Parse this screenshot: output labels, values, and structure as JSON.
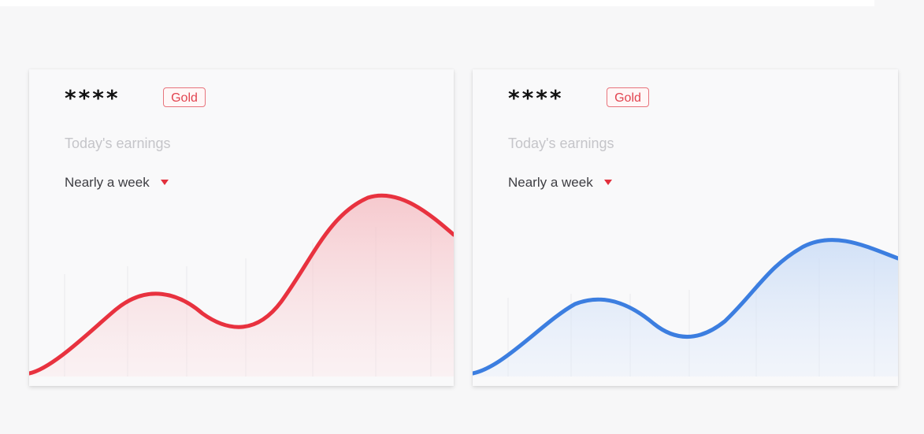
{
  "cards": [
    {
      "masked_value": "****",
      "badge": "Gold",
      "earnings_label": "Today's earnings",
      "period_label": "Nearly a week",
      "line_color": "#e8323f",
      "fill_color": "#f7c9cd",
      "caret_color": "#e2303c"
    },
    {
      "masked_value": "****",
      "badge": "Gold",
      "earnings_label": "Today's earnings",
      "period_label": "Nearly a week",
      "line_color": "#3c7ee0",
      "fill_color": "#cfe0f8",
      "caret_color": "#e2303c"
    }
  ],
  "chart_data": [
    {
      "type": "area",
      "x": [
        0,
        1,
        2,
        3,
        4,
        5,
        6
      ],
      "values": [
        0,
        0.45,
        0.25,
        0.4,
        1.0,
        0.78,
        0.7
      ],
      "xlabel": "",
      "ylabel": "",
      "grid": false
    },
    {
      "type": "area",
      "x": [
        0,
        1,
        2,
        3,
        4,
        5,
        6
      ],
      "values": [
        0,
        0.42,
        0.22,
        0.38,
        0.8,
        0.68,
        0.6
      ],
      "xlabel": "",
      "ylabel": "",
      "grid": false
    }
  ]
}
